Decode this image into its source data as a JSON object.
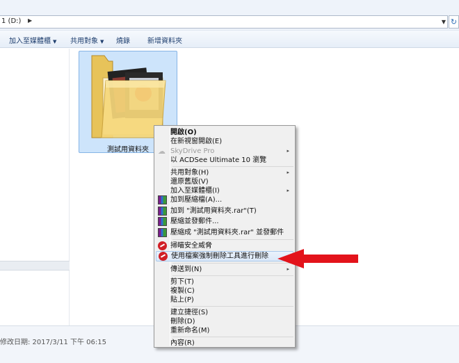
{
  "address_bar": {
    "path": "1 (D:)",
    "separator_glyph": "▶",
    "dropdown_glyph": "▼",
    "refresh_glyph": "↻"
  },
  "toolbar": {
    "items": [
      {
        "label": "加入至媒體櫃",
        "dropdown": true
      },
      {
        "label": "共用對象",
        "dropdown": true
      },
      {
        "label": "燒錄",
        "dropdown": false
      },
      {
        "label": "新增資料夾",
        "dropdown": false
      }
    ],
    "caret": "▼"
  },
  "folder": {
    "name": "測試用資料夾"
  },
  "details": {
    "modified": "修改日期: 2017/3/11 下午 06:15"
  },
  "context_menu": {
    "items": [
      {
        "label": "開啟(O)",
        "bold": true
      },
      {
        "label": "在新視窗開啟(E)"
      },
      {
        "label": "SkyDrive Pro",
        "disabled": true,
        "submenu": true,
        "icon": "cloud-icon"
      },
      {
        "label": "以 ACDSee Ultimate 10 瀏覽"
      },
      {
        "label": "共用對象(H)",
        "submenu": true
      },
      {
        "label": "還原舊版(V)"
      },
      {
        "label": "加入至媒體櫃(I)",
        "submenu": true
      },
      {
        "label": "加到壓縮檔(A)...",
        "icon": "winrar-icon"
      },
      {
        "label": "加到 \"測試用資料夾.rar\"(T)",
        "icon": "winrar-icon"
      },
      {
        "label": "壓縮並發郵件...",
        "icon": "winrar-icon"
      },
      {
        "label": "壓縮成 \"測試用資料夾.rar\" 並發郵件",
        "icon": "winrar-icon"
      },
      {
        "label": "掃瞄安全威脅",
        "icon": "trend-micro-icon"
      },
      {
        "label": "使用檔案強制刪除工具進行刪除",
        "icon": "trend-micro-icon",
        "highlighted": true
      },
      {
        "label": "傳送到(N)",
        "submenu": true
      },
      {
        "label": "剪下(T)"
      },
      {
        "label": "複製(C)"
      },
      {
        "label": "貼上(P)"
      },
      {
        "label": "建立捷徑(S)"
      },
      {
        "label": "刪除(D)"
      },
      {
        "label": "重新命名(M)"
      },
      {
        "label": "內容(R)"
      }
    ],
    "submenu_glyph": "▸"
  },
  "colors": {
    "selection": "#cde4fb",
    "menu_highlight": "#dbe8f8",
    "annotation_arrow": "#e3131b"
  }
}
